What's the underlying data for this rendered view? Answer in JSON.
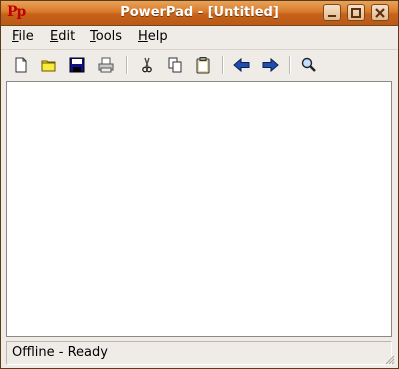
{
  "window": {
    "app_icon_text": "Pp",
    "title": "PowerPad - [Untitled]",
    "controls": [
      "minimize-icon",
      "maximize-icon",
      "close-icon"
    ]
  },
  "menu": {
    "items": [
      {
        "mnemonic": "F",
        "rest": "ile"
      },
      {
        "mnemonic": "E",
        "rest": "dit"
      },
      {
        "mnemonic": "T",
        "rest": "ools"
      },
      {
        "mnemonic": "H",
        "rest": "elp"
      }
    ]
  },
  "toolbar": {
    "buttons": [
      "new-file-icon",
      "open-folder-icon",
      "save-icon",
      "print-icon",
      "cut-icon",
      "copy-icon",
      "paste-icon",
      "back-arrow-icon",
      "forward-arrow-icon",
      "search-icon"
    ]
  },
  "editor": {
    "content": ""
  },
  "status": {
    "text": "Offline - Ready"
  },
  "colors": {
    "titlebar": "#d97a2a",
    "menubar": "#efebe7",
    "arrow_blue": "#1e4fb0"
  }
}
